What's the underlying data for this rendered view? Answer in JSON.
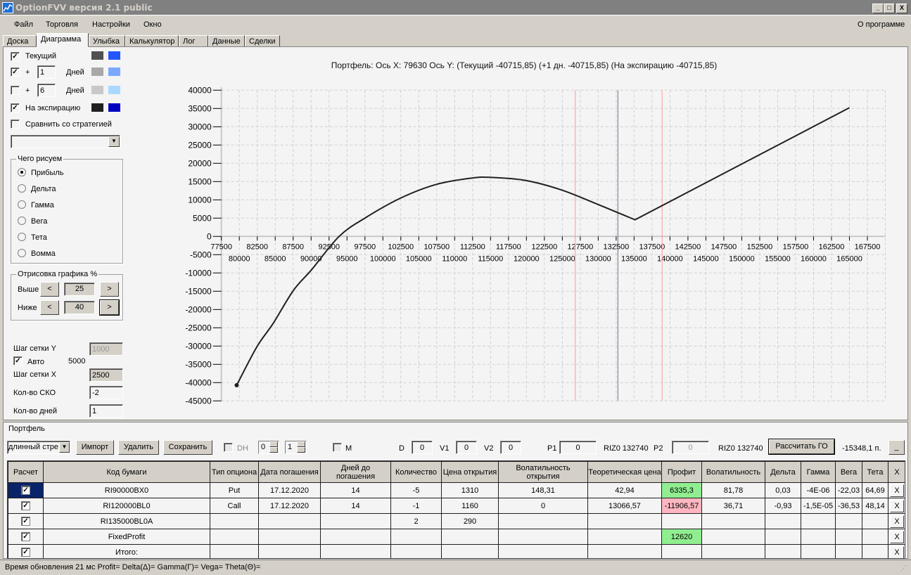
{
  "window": {
    "title": "OptionFVV версия 2.1 public",
    "app_icon": "chart-icon",
    "buttons": [
      "_",
      "□",
      "X"
    ]
  },
  "menu": {
    "items": [
      "Файл",
      "Торговля",
      "Настройки",
      "Окно"
    ],
    "about": "О программе"
  },
  "tabs": [
    "Доска",
    "Диаграмма",
    "Улыбка",
    "Калькулятор",
    "Лог",
    "Данные",
    "Сделки"
  ],
  "active_tab": "Диаграмма",
  "left": {
    "current": {
      "label": "Текущий",
      "checked": true,
      "colors": [
        "#505050",
        "#2255ff"
      ]
    },
    "plus1": {
      "plus": "+",
      "value": "1",
      "days": "Дней",
      "checked": true,
      "colors": [
        "#a8a8a8",
        "#7aa8ff"
      ]
    },
    "plus2": {
      "plus": "+",
      "value": "6",
      "days": "Дней",
      "checked": false,
      "colors": [
        "#c8c8c8",
        "#aad8ff"
      ]
    },
    "expiry": {
      "label": "На экспирацию",
      "checked": true,
      "colors": [
        "#202020",
        "#0000c0"
      ]
    },
    "compare": {
      "label": "Сравнить со стратегией",
      "checked": false
    },
    "strategy_select": "",
    "what_group": {
      "title": "Чего рисуем",
      "options": [
        "Прибыль",
        "Дельта",
        "Гамма",
        "Вега",
        "Тета",
        "Вомма"
      ],
      "selected": "Прибыль"
    },
    "draw_group": {
      "title": "Отрисовка графика %",
      "above_label": "Выше",
      "above": "25",
      "below_label": "Ниже",
      "below": "40",
      "dec": "<",
      "inc": ">"
    },
    "grid_y_label": "Шаг сетки Y",
    "grid_y": "1000",
    "auto_label": "Авто",
    "auto_checked": true,
    "auto_value": "5000",
    "grid_x_label": "Шаг сетки X",
    "grid_x": "2500",
    "sko_label": "Кол-во СКО",
    "sko": "-2",
    "days_label": "Кол-во дней",
    "days": "1"
  },
  "chart_data": {
    "type": "line",
    "title": "Портфель: Ось X: 79630 Ось Y:  (Текущий -40715,85)  (+1 дн.  -40715,85)  (На экспирацию -40715,85)",
    "xlim": [
      77500,
      167500
    ],
    "ylim": [
      -45000,
      40000
    ],
    "x_ticks_top": [
      77500,
      82500,
      87500,
      92500,
      97500,
      102500,
      107500,
      112500,
      117500,
      122500,
      127500,
      132500,
      137500,
      142500,
      147500,
      152500,
      157500,
      162500,
      167500
    ],
    "x_ticks_bottom": [
      80000,
      85000,
      90000,
      95000,
      100000,
      105000,
      110000,
      115000,
      120000,
      125000,
      130000,
      135000,
      140000,
      145000,
      150000,
      155000,
      160000,
      165000
    ],
    "y_ticks": [
      40000,
      35000,
      30000,
      25000,
      20000,
      15000,
      10000,
      5000,
      0,
      -5000,
      -10000,
      -15000,
      -20000,
      -25000,
      -30000,
      -35000,
      -40000,
      -45000
    ],
    "grid": true,
    "x_grid_step": 2500,
    "y_grid_step": 5000,
    "series": [
      {
        "color": "#202020",
        "points": [
          [
            79630,
            -40716
          ],
          [
            82450,
            -30190
          ],
          [
            84720,
            -23780
          ],
          [
            87530,
            -14800
          ],
          [
            90100,
            -9040
          ],
          [
            93900,
            0
          ],
          [
            97540,
            5060
          ],
          [
            102500,
            10510
          ],
          [
            107450,
            14230
          ],
          [
            112400,
            15960
          ],
          [
            115050,
            16150
          ],
          [
            119850,
            15320
          ],
          [
            124800,
            12760
          ],
          [
            129760,
            8910
          ],
          [
            135130,
            4550
          ],
          [
            165000,
            35200
          ]
        ]
      }
    ],
    "marker": [
      79630,
      -40716
    ],
    "vlines": [
      {
        "x": 126800,
        "color": "#ff9999"
      },
      {
        "x": 132740,
        "color": "#6a7090"
      },
      {
        "x": 138900,
        "color": "#ff9999"
      }
    ]
  },
  "portfolio": {
    "title": "Портфель",
    "strategy": "длинный стре",
    "import": "Импорт",
    "delete": "Удалить",
    "save": "Сохранить",
    "dh_label": "DH",
    "dh_checked": false,
    "spin1": "0",
    "spin2": "1",
    "m_label": "M",
    "m_checked": false,
    "d_label": "D",
    "d": "0",
    "v1_label": "V1",
    "v1": "0",
    "v2_label": "V2",
    "v2": "0",
    "p1_label": "P1",
    "p1": "0",
    "p1_ticker": "RIZ0 132740",
    "p2_label": "P2",
    "p2": "0",
    "p2_ticker": "RIZ0 132740",
    "calc_go": "Рассчитать ГО",
    "go_value": "-15348,1 п.",
    "minimize": "_",
    "columns": [
      "Расчет",
      "Код бумаги",
      "Тип опциона",
      "Дата погашения",
      "Дней до погашения",
      "Количество",
      "Цена открытия",
      "Волатильность открытия",
      "Теоретическая цена",
      "Профит",
      "Волатильность",
      "Дельта",
      "Гамма",
      "Вега",
      "Тета",
      "X"
    ],
    "rows": [
      {
        "checked": true,
        "cells": [
          "RI90000BX0",
          "Put",
          "17.12.2020",
          "14",
          "-5",
          "1310",
          "148,31",
          "42,94",
          "6335,3",
          "81,78",
          "0,03",
          "-4E-06",
          "-22,03",
          "64,69"
        ],
        "profit_color": "green"
      },
      {
        "checked": true,
        "cells": [
          "RI120000BL0",
          "Call",
          "17.12.2020",
          "14",
          "-1",
          "1160",
          "0",
          "13066,57",
          "-11906,57",
          "36,71",
          "-0,93",
          "-1,5E-05",
          "-36,53",
          "48,14"
        ],
        "profit_color": "red"
      },
      {
        "checked": true,
        "cells": [
          "RI135000BL0A",
          "",
          "",
          "",
          "2",
          "290",
          "",
          "",
          "",
          "",
          "",
          "",
          "",
          ""
        ],
        "profit_color": ""
      },
      {
        "checked": true,
        "cells": [
          "FixedProfit",
          "",
          "",
          "",
          "",
          "",
          "",
          "",
          "12620",
          "",
          "",
          "",
          "",
          ""
        ],
        "profit_color": "green"
      },
      {
        "checked": true,
        "cells": [
          "Итого:",
          "",
          "",
          "",
          "",
          "",
          "",
          "",
          "",
          "",
          "",
          "",
          "",
          ""
        ],
        "profit_color": ""
      }
    ],
    "row_delete": "X"
  },
  "status": "Время обновления 21 мс  Profit= Delta(Δ)= Gamma(Γ)= Vega= Theta(Θ)="
}
